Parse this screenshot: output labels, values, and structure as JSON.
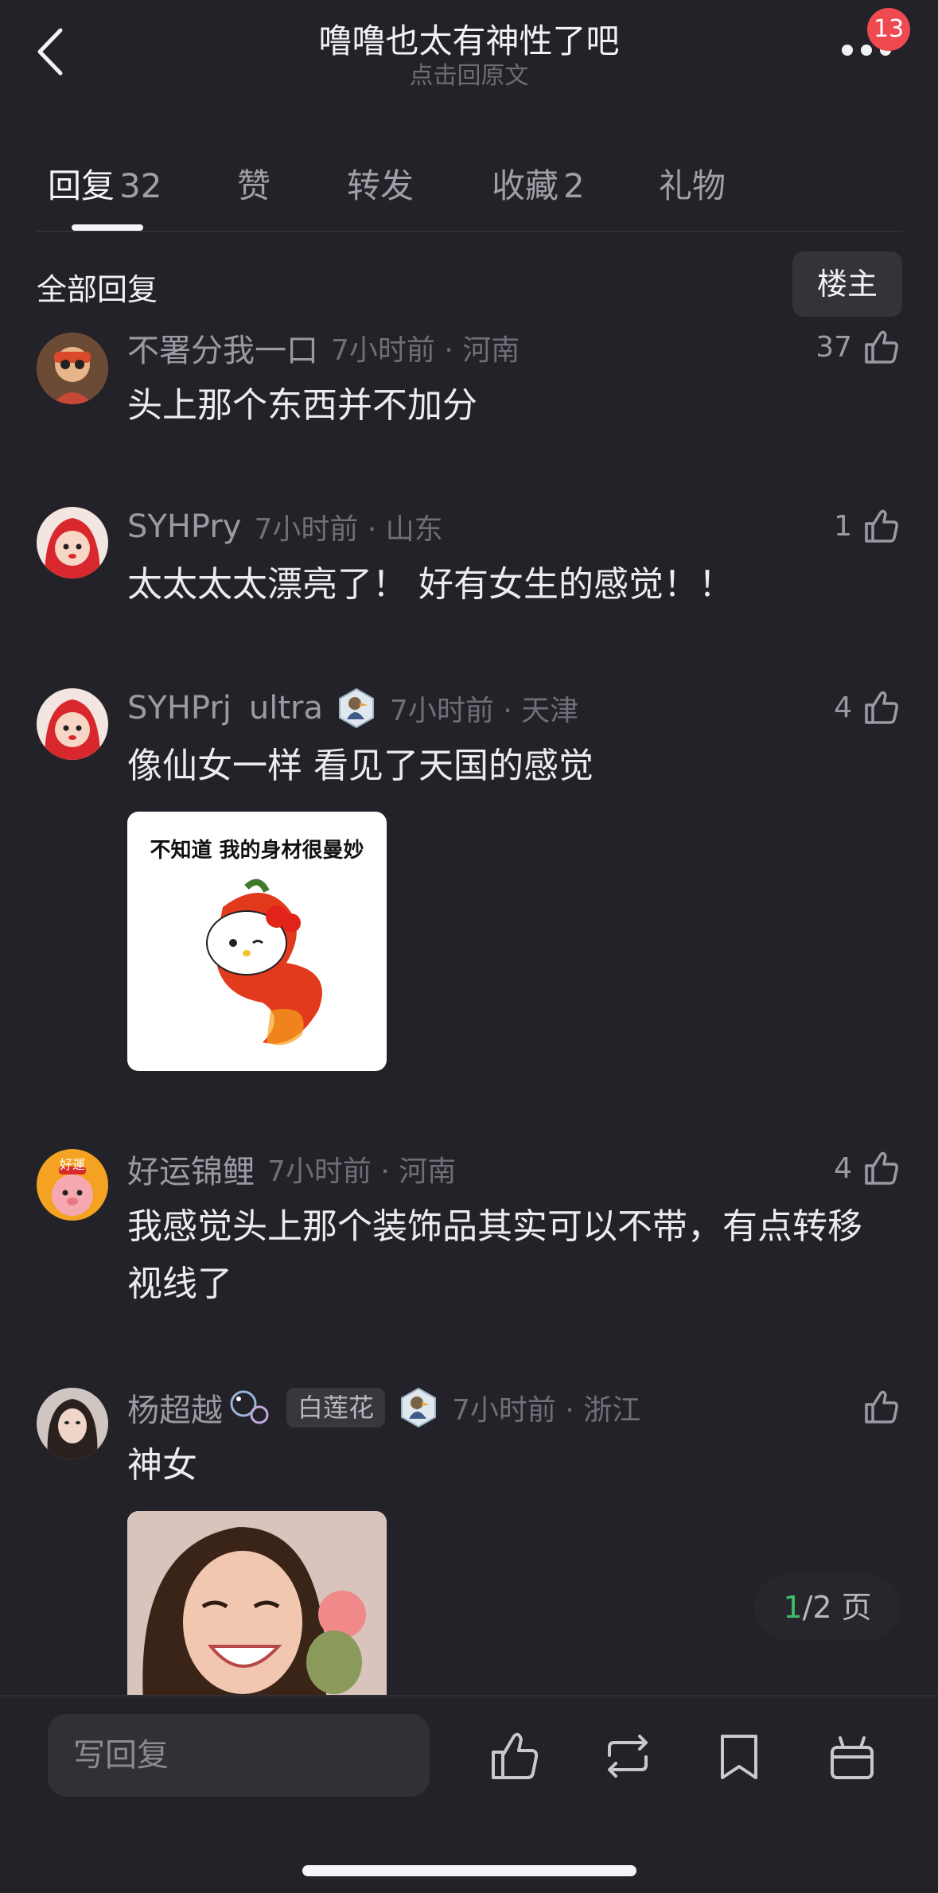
{
  "header": {
    "title": "噜噜也太有神性了吧",
    "subtitle": "点击回原文",
    "badge": "13"
  },
  "tabs": [
    {
      "label": "回复",
      "count": "32"
    },
    {
      "label": "赞",
      "count": ""
    },
    {
      "label": "转发",
      "count": ""
    },
    {
      "label": "收藏",
      "count": "2"
    },
    {
      "label": "礼物",
      "count": ""
    }
  ],
  "section": {
    "title": "全部回复",
    "owner_button": "楼主"
  },
  "comments": [
    {
      "username": "不署分我一口",
      "time": "7小时前 · 河南",
      "likes": "37",
      "text": "头上那个东西并不加分"
    },
    {
      "username": "SYHPry",
      "time": "7小时前 · 山东",
      "likes": "1",
      "text": "太太太太漂亮了！ 好有女生的感觉！！"
    },
    {
      "username": "SYHPrj",
      "suffix": "ultra",
      "time": "7小时前 · 天津",
      "likes": "4",
      "text": "像仙女一样 看见了天国的感觉",
      "sticker_caption": "不知道 我的身材很曼妙"
    },
    {
      "username": "好运锦鲤",
      "avatar_text": "好運",
      "time": "7小时前 · 河南",
      "likes": "4",
      "text": "我感觉头上那个装饰品其实可以不带，有点转移视线了"
    },
    {
      "username": "杨超越",
      "tag": "白莲花",
      "time": "7小时前 · 浙江",
      "likes": "",
      "text": "神女"
    }
  ],
  "pager": {
    "current": "1",
    "total": "/2 页"
  },
  "bottom_bar": {
    "reply_placeholder": "写回复"
  },
  "colors": {
    "background": "#222228",
    "badge": "#ef4a50",
    "pager_current": "#3fbf6a"
  }
}
